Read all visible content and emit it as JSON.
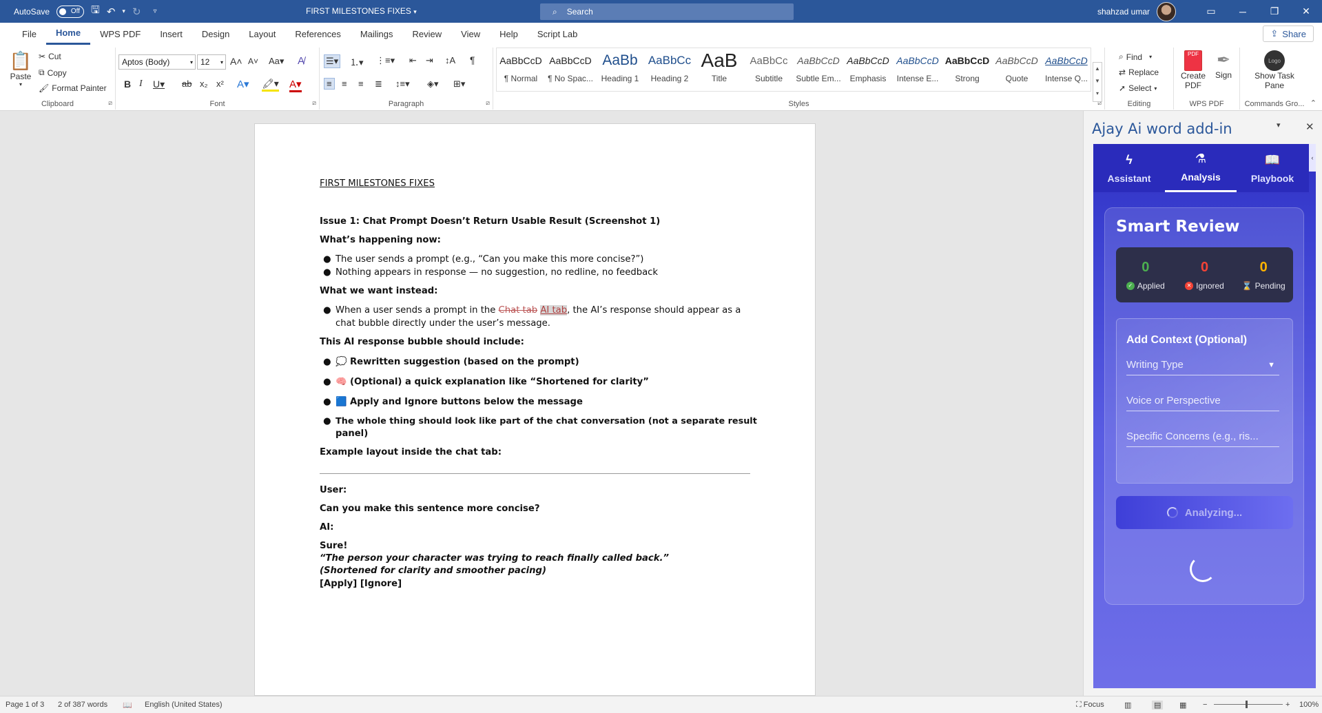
{
  "titlebar": {
    "autosave_label": "AutoSave",
    "autosave_state": "Off",
    "document_title": "FIRST MILESTONES FIXES",
    "search_placeholder": "Search",
    "user_name": "shahzad umar"
  },
  "menu": {
    "tabs": [
      "File",
      "Home",
      "WPS PDF",
      "Insert",
      "Design",
      "Layout",
      "References",
      "Mailings",
      "Review",
      "View",
      "Help",
      "Script Lab"
    ],
    "active": "Home",
    "share_label": "Share"
  },
  "ribbon": {
    "clipboard": {
      "paste": "Paste",
      "cut": "Cut",
      "copy": "Copy",
      "format_painter": "Format Painter",
      "label": "Clipboard"
    },
    "font": {
      "name": "Aptos (Body)",
      "size": "12",
      "label": "Font"
    },
    "paragraph": {
      "label": "Paragraph"
    },
    "styles": {
      "items": [
        {
          "preview": "AaBbCcD",
          "label": "¶ Normal"
        },
        {
          "preview": "AaBbCcD",
          "label": "¶ No Spac..."
        },
        {
          "preview": "AaBb",
          "label": "Heading 1"
        },
        {
          "preview": "AaBbCc",
          "label": "Heading 2"
        },
        {
          "preview": "AaB",
          "label": "Title"
        },
        {
          "preview": "AaBbCc",
          "label": "Subtitle"
        },
        {
          "preview": "AaBbCcD",
          "label": "Subtle Em..."
        },
        {
          "preview": "AaBbCcD",
          "label": "Emphasis"
        },
        {
          "preview": "AaBbCcD",
          "label": "Intense E..."
        },
        {
          "preview": "AaBbCcD",
          "label": "Strong"
        },
        {
          "preview": "AaBbCcD",
          "label": "Quote"
        },
        {
          "preview": "AaBbCcD",
          "label": "Intense Q..."
        }
      ],
      "label": "Styles"
    },
    "editing": {
      "find": "Find",
      "replace": "Replace",
      "select": "Select",
      "label": "Editing"
    },
    "wps": {
      "create_pdf": "Create PDF",
      "sign": "Sign",
      "label": "WPS PDF"
    },
    "commands": {
      "show_task_pane": "Show Task Pane",
      "label": "Commands Gro...",
      "logo": "Logo"
    }
  },
  "document": {
    "heading": "FIRST MILESTONES FIXES",
    "issue_title": "Issue 1: Chat Prompt Doesn’t Return Usable Result (Screenshot 1)",
    "now_label": "What’s happening now:",
    "now_bullets": [
      "The user sends a prompt (e.g., “Can you make this more concise?”)",
      "Nothing appears in response — no suggestion, no redline, no feedback"
    ],
    "want_label": "What we want instead:",
    "want_pre": "When a user sends a prompt in the ",
    "want_deleted": "Chat tab",
    "want_inserted": "AI tab",
    "want_post": ", the AI’s response should appear as a",
    "want_line2": "chat bubble directly under the user’s message.",
    "bubble_label": "This AI response bubble should include:",
    "bubble_items": [
      "💭 Rewritten suggestion (based on the prompt)",
      "🧠 (Optional) a quick explanation like “Shortened for clarity”",
      "🟦 Apply and Ignore buttons below the message"
    ],
    "whole_line1": "The whole thing should look like part of the chat conversation (not a separate result",
    "whole_line2": "panel)",
    "example_label": "Example layout inside the chat tab:",
    "user_label": "User:",
    "user_msg": "Can you make this sentence more concise?",
    "ai_label": "AI:",
    "sure": "Sure!",
    "quote": "“The person your character was trying to reach finally called back.”",
    "note": "(Shortened for clarity and smoother pacing)",
    "actions": "[Apply] [Ignore]"
  },
  "pane": {
    "title": "Ajay Ai word add-in",
    "tabs": [
      {
        "label": "Assistant",
        "icon": "bolt-icon"
      },
      {
        "label": "Analysis",
        "icon": "flask-icon"
      },
      {
        "label": "Playbook",
        "icon": "book-icon"
      }
    ],
    "active_tab": "Analysis",
    "smart_review": {
      "title": "Smart Review",
      "stats": [
        {
          "value": "0",
          "label": "Applied",
          "color": "#4caf50"
        },
        {
          "value": "0",
          "label": "Ignored",
          "color": "#f44336"
        },
        {
          "value": "0",
          "label": "Pending",
          "color": "#ffb300"
        }
      ],
      "context_title": "Add Context (Optional)",
      "writing_type": "Writing Type",
      "voice": "Voice or Perspective",
      "concerns": "Specific Concerns (e.g., ris...",
      "analyze_label": "Analyzing..."
    }
  },
  "status": {
    "page": "Page 1 of 3",
    "words": "2 of 387 words",
    "language": "English (United States)",
    "focus": "Focus",
    "zoom": "100%"
  }
}
